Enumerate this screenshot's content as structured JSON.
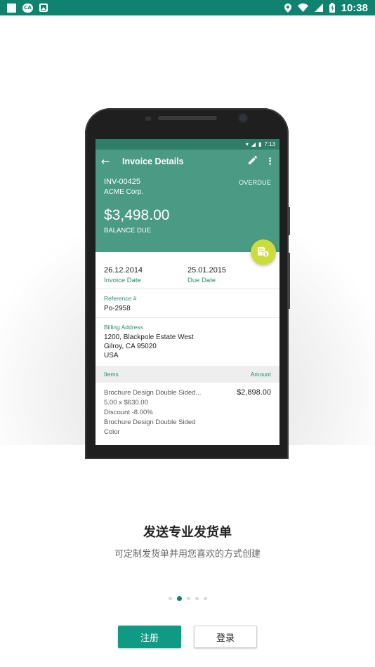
{
  "status_bar": {
    "time": "10:38",
    "left_icons": [
      "notification-square-icon",
      "app-notification-icon",
      "image-notification-icon"
    ],
    "right_icons": [
      "location-icon",
      "wifi-icon",
      "signal-icon",
      "battery-icon"
    ]
  },
  "mockup": {
    "status_time": "7:13",
    "appbar_title": "Invoice Details",
    "invoice_number": "INV-00425",
    "invoice_status": "OVERDUE",
    "client_name": "ACME Corp.",
    "balance_amount": "$3,498.00",
    "balance_label": "BALANCE DUE",
    "invoice_date": "26.12.2014",
    "invoice_date_label": "Invoice Date",
    "due_date": "25.01.2015",
    "due_date_label": "Due Date",
    "reference_label": "Reference #",
    "reference_value": "Po-2958",
    "billing_label": "Billing Address",
    "billing_line1": "1200, Blackpole Estate West",
    "billing_line2": "Gilroy, CA 95020",
    "billing_line3": "USA",
    "items_header": "Items",
    "amount_header": "Amount",
    "item_name": "Brochure Design Double Sided...",
    "item_qty": "5.00 x $630.00",
    "item_discount": "Discount -8.00%",
    "item_desc1": "Brochure Design Double Sided",
    "item_desc2": "Color",
    "item_amount": "$2,898.00"
  },
  "onboarding": {
    "title": "发送专业发货单",
    "subtitle": "可定制发货单并用您喜欢的方式创建",
    "page_count": 5,
    "active_page": 2
  },
  "buttons": {
    "register": "注册",
    "login": "登录"
  },
  "colors": {
    "status_bar": "#0f8270",
    "accent": "#0f9a84",
    "mock_header": "#4a9a84",
    "fab": "#cddc39"
  }
}
